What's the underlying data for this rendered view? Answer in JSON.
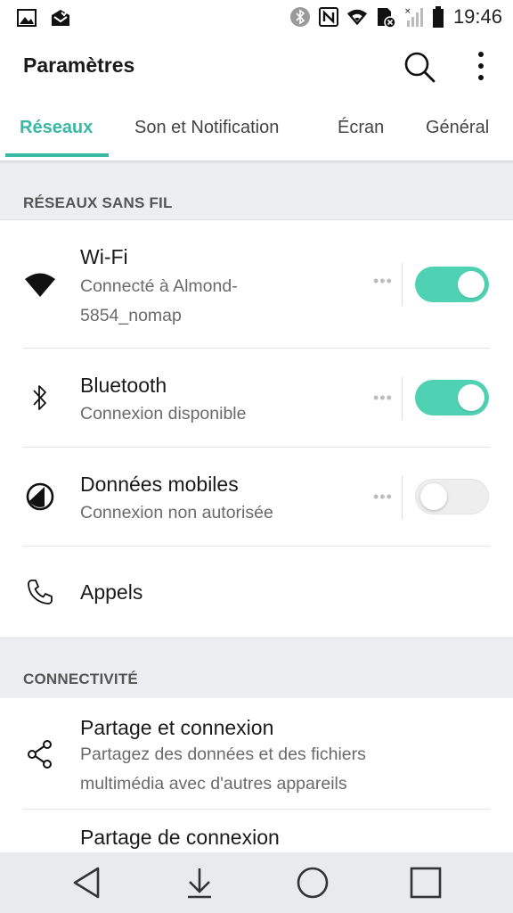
{
  "status_bar": {
    "time": "19:46",
    "left_icons": [
      "gallery-icon",
      "mail-icon"
    ],
    "right_icons": [
      "bluetooth-icon",
      "nfc-icon",
      "wifi-icon",
      "sim-icon",
      "signal-icon",
      "battery-icon"
    ]
  },
  "app_bar": {
    "title": "Paramètres",
    "search_icon": "search-icon",
    "more_icon": "more-vert-icon"
  },
  "tabs": [
    {
      "label": "Réseaux",
      "active": true
    },
    {
      "label": "Son et Notification",
      "active": false
    },
    {
      "label": "Écran",
      "active": false
    },
    {
      "label": "Général",
      "active": false
    }
  ],
  "accent_color": "#38b9a4",
  "toggle_on_color": "#4fd2b3",
  "sections": [
    {
      "header": "RÉSEAUX SANS FIL",
      "items": [
        {
          "title": "Wi-Fi",
          "subtitle": "Connecté à Almond-5854_nomap",
          "icon": "wifi-icon",
          "toggle": true
        },
        {
          "title": "Bluetooth",
          "subtitle": "Connexion disponible",
          "icon": "bluetooth-icon",
          "toggle": true
        },
        {
          "title": "Données mobiles",
          "subtitle": "Connexion non autorisée",
          "icon": "mobile-data-icon",
          "toggle": false
        },
        {
          "title": "Appels",
          "icon": "phone-icon"
        }
      ]
    },
    {
      "header": "CONNECTIVITÉ",
      "items": [
        {
          "title": "Partage et connexion",
          "subtitle": "Partagez des données et des fichiers multimédia avec d'autres appareils",
          "icon": "share-icon"
        },
        {
          "title": "Partage de connexion"
        }
      ]
    }
  ],
  "nav_bar": [
    "back-icon",
    "notification-pulldown-icon",
    "home-icon",
    "recents-icon"
  ]
}
